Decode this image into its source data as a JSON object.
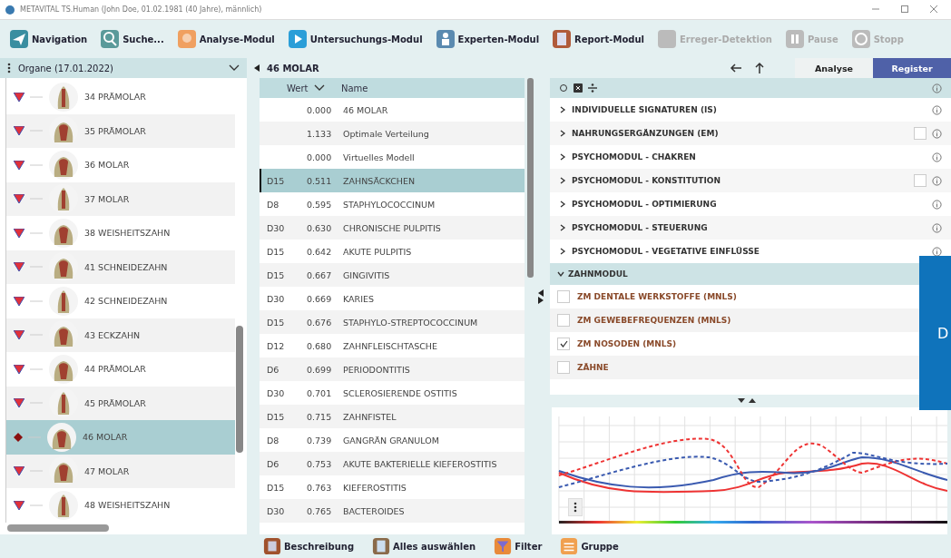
{
  "window": {
    "title": "METAVITAL TS.Human (John Doe, 01.02.1981 (40 Jahre), männlich)"
  },
  "toolbar": [
    {
      "label": "Navigation",
      "disabled": false
    },
    {
      "label": "Suche...",
      "disabled": false
    },
    {
      "label": "Analyse-Modul",
      "disabled": false
    },
    {
      "label": "Untersuchungs-Modul",
      "disabled": false
    },
    {
      "label": "Experten-Modul",
      "disabled": false
    },
    {
      "label": "Report-Modul",
      "disabled": false
    },
    {
      "label": "Erreger-Detektion",
      "disabled": true
    },
    {
      "label": "Pause",
      "disabled": true
    },
    {
      "label": "Stopp",
      "disabled": true
    }
  ],
  "organ_panel": {
    "dropdown": "Organe (17.01.2022)",
    "items": [
      {
        "label": "34 PRÄMOLAR",
        "selected": false
      },
      {
        "label": "35 PRÄMOLAR",
        "selected": false
      },
      {
        "label": "36 MOLAR",
        "selected": false
      },
      {
        "label": "37 MOLAR",
        "selected": false
      },
      {
        "label": "38 WEISHEITSZAHN",
        "selected": false
      },
      {
        "label": "41 SCHNEIDEZAHN",
        "selected": false
      },
      {
        "label": "42 SCHNEIDEZAHN",
        "selected": false
      },
      {
        "label": "43 ECKZAHN",
        "selected": false
      },
      {
        "label": "44 PRÄMOLAR",
        "selected": false
      },
      {
        "label": "45 PRÄMOLAR",
        "selected": false
      },
      {
        "label": "46 MOLAR",
        "selected": true
      },
      {
        "label": "47 MOLAR",
        "selected": false
      },
      {
        "label": "48 WEISHEITSZAHN",
        "selected": false
      }
    ]
  },
  "results": {
    "title": "46 MOLAR",
    "columns": [
      "Wert",
      "Name"
    ],
    "rows": [
      {
        "potency": "",
        "value": "0.000",
        "name": "46 MOLAR",
        "selected": false
      },
      {
        "potency": "",
        "value": "1.133",
        "name": "Optimale Verteilung",
        "selected": false
      },
      {
        "potency": "",
        "value": "0.000",
        "name": "Virtuelles Modell",
        "selected": false
      },
      {
        "potency": "D15",
        "value": "0.511",
        "name": "ZAHNSÄCKCHEN",
        "selected": true
      },
      {
        "potency": "D8",
        "value": "0.595",
        "name": "STAPHYLOCOCCINUM",
        "selected": false
      },
      {
        "potency": "D30",
        "value": "0.630",
        "name": "CHRONISCHE PULPITIS",
        "selected": false
      },
      {
        "potency": "D15",
        "value": "0.642",
        "name": "AKUTE PULPITIS",
        "selected": false
      },
      {
        "potency": "D15",
        "value": "0.667",
        "name": "GINGIVITIS",
        "selected": false
      },
      {
        "potency": "D30",
        "value": "0.669",
        "name": "KARIES",
        "selected": false
      },
      {
        "potency": "D15",
        "value": "0.676",
        "name": "STAPHYLO-STREPTOCOCCINUM",
        "selected": false
      },
      {
        "potency": "D12",
        "value": "0.680",
        "name": "ZAHNFLEISCHTASCHE",
        "selected": false
      },
      {
        "potency": "D6",
        "value": "0.699",
        "name": "PERIODONTITIS",
        "selected": false
      },
      {
        "potency": "D30",
        "value": "0.701",
        "name": "SCLEROSIERENDE OSTITIS",
        "selected": false
      },
      {
        "potency": "D15",
        "value": "0.715",
        "name": "ZAHNFISTEL",
        "selected": false
      },
      {
        "potency": "D8",
        "value": "0.739",
        "name": "GANGRÄN GRANULOM",
        "selected": false
      },
      {
        "potency": "D6",
        "value": "0.753",
        "name": "AKUTE BAKTERIELLE KIEFEROSTITIS",
        "selected": false
      },
      {
        "potency": "D15",
        "value": "0.763",
        "name": "KIEFEROSTITIS",
        "selected": false
      },
      {
        "potency": "D30",
        "value": "0.765",
        "name": "BACTEROIDES",
        "selected": false
      }
    ]
  },
  "tabs": [
    {
      "label": "Analyse",
      "selected": false
    },
    {
      "label": "Register",
      "selected": true
    }
  ],
  "register": {
    "categories": [
      {
        "label": "INDIVIDUELLE SIGNATUREN (IS)",
        "kind": "plain"
      },
      {
        "label": "NAHRUNGSERGÄNZUNGEN (EM)",
        "kind": "checkbox",
        "checked": false
      },
      {
        "label": "PSYCHOMODUL - CHAKREN",
        "kind": "plain"
      },
      {
        "label": "PSYCHOMODUL - KONSTITUTION",
        "kind": "checkbox",
        "checked": false
      },
      {
        "label": "PSYCHOMODUL - OPTIMIERUNG",
        "kind": "plain"
      },
      {
        "label": "PSYCHOMODUL - STEUERUNG",
        "kind": "plain"
      },
      {
        "label": "PSYCHOMODUL - VEGETATIVE EINFLÜSSE",
        "kind": "plain"
      }
    ],
    "section": {
      "label": "ZAHNMODUL",
      "expanded": true,
      "items": [
        {
          "label": "ZM DENTALE WERKSTOFFE (MNLS)",
          "checked": false
        },
        {
          "label": "ZM GEWEBEFREQUENZEN (MNLS)",
          "checked": false
        },
        {
          "label": "ZM NOSODEN (MNLS)",
          "checked": true
        },
        {
          "label": "ZÄHNE",
          "checked": false
        }
      ]
    }
  },
  "footer": [
    "Beschreibung",
    "Alles auswählen",
    "Filter",
    "Gruppe"
  ],
  "overlay": {
    "text": "D"
  }
}
